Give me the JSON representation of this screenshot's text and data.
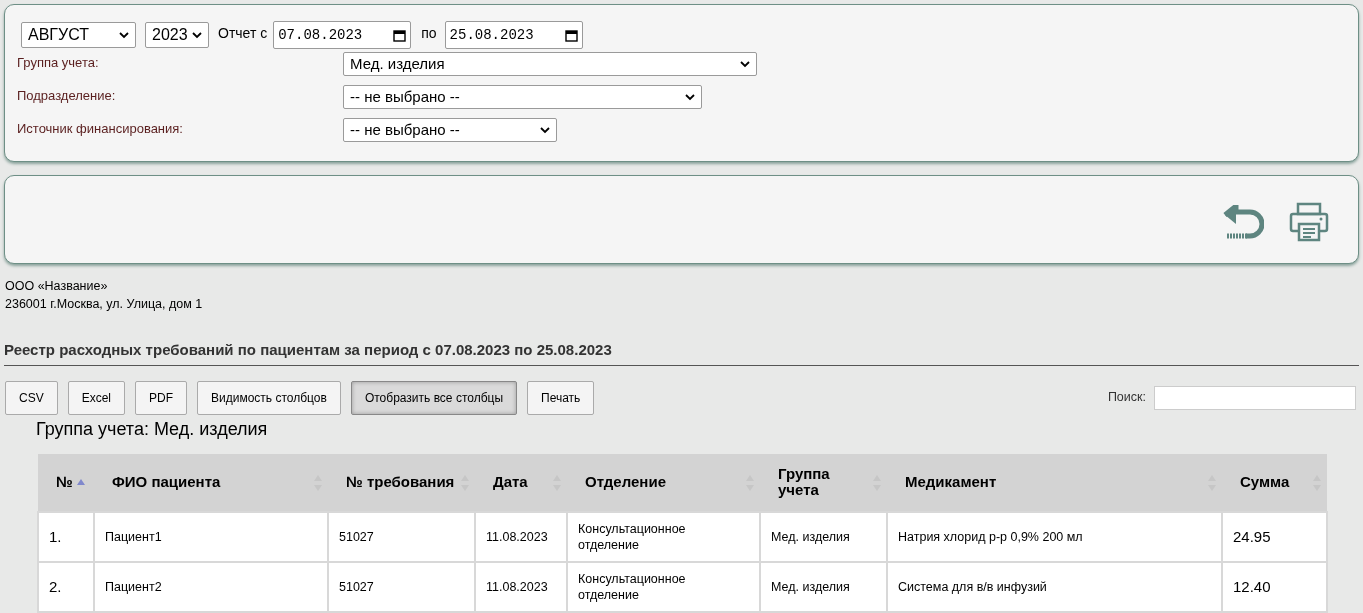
{
  "filters": {
    "month": "АВГУСТ",
    "year": "2023",
    "report_from_label": "Отчет с",
    "date_from": "07.08.2023",
    "to_label": "по",
    "date_to": "25.08.2023",
    "fields": [
      {
        "label": "Группа учета:",
        "value": "Мед. изделия"
      },
      {
        "label": "Подразделение:",
        "value": "-- не выбрано --"
      },
      {
        "label": "Источник финансирования:",
        "value": "-- не выбрано --"
      }
    ]
  },
  "org": {
    "name": "ООО «Название»",
    "address": "236001 г.Москва, ул. Улица, дом 1"
  },
  "report_title": "Реестр расходных требований по пациентам за период с 07.08.2023 по 25.08.2023",
  "buttons": [
    {
      "label": "CSV",
      "pressed": false
    },
    {
      "label": "Excel",
      "pressed": false
    },
    {
      "label": "PDF",
      "pressed": false
    },
    {
      "label": "Видимость столбцов",
      "pressed": false
    },
    {
      "label": "Отобразить все столбцы",
      "pressed": true
    },
    {
      "label": "Печать",
      "pressed": false
    }
  ],
  "search": {
    "label": "Поиск:"
  },
  "group_heading": "Группа учета: Мед. изделия",
  "table": {
    "columns": [
      {
        "label": "№",
        "sorted": true
      },
      {
        "label": "ФИО пациента",
        "sorted": false
      },
      {
        "label": "№ требования",
        "sorted": false
      },
      {
        "label": "Дата",
        "sorted": false
      },
      {
        "label": "Отделение",
        "sorted": false
      },
      {
        "label": "Группа учета",
        "sorted": false
      },
      {
        "label": "Медикамент",
        "sorted": false
      },
      {
        "label": "Сумма",
        "sorted": false
      }
    ],
    "rows": [
      [
        "1.",
        "Пациент1",
        "51027",
        "11.08.2023",
        "Консультационное отделение",
        "Мед. изделия",
        "Натрия хлорид р-р 0,9% 200 мл",
        "24.95"
      ],
      [
        "2.",
        "Пациент2",
        "51027",
        "11.08.2023",
        "Консультационное отделение",
        "Мед. изделия",
        "Система для в/в инфузий",
        "12.40"
      ]
    ]
  }
}
